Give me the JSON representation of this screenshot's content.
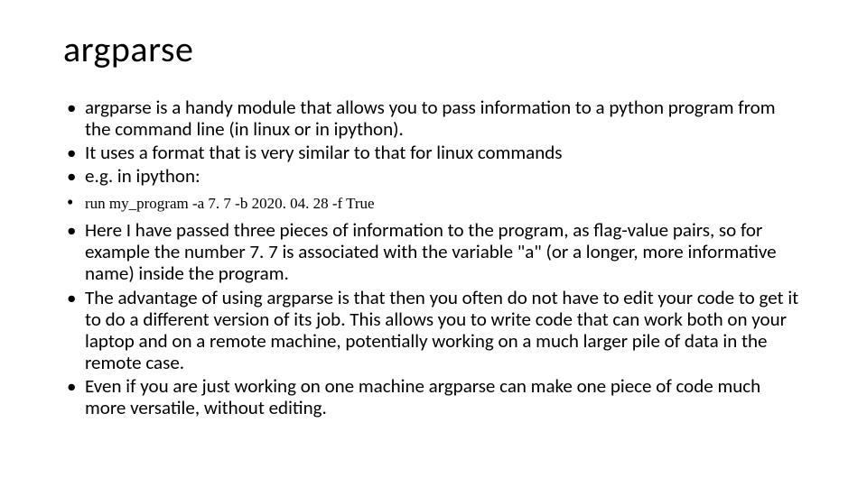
{
  "title": "argparse",
  "bullets": [
    {
      "text": "argparse is a handy module that allows you to pass information to a python program from the command line (in linux or in ipython).",
      "code": false
    },
    {
      "text": "It uses a format that is very similar to that for linux commands",
      "code": false
    },
    {
      "text": "e.g. in ipython:",
      "code": false
    },
    {
      "text": "run my_program -a 7. 7 -b 2020. 04. 28 -f True",
      "code": true
    },
    {
      "text": "Here I have passed three pieces of information to the program, as flag-value pairs, so for example the number 7. 7 is associated with the variable \"a\" (or a longer, more informative name) inside the program.",
      "code": false
    },
    {
      "text": "The advantage of using argparse is that then you often do not have to edit your code to get it to do a different version of its job.  This allows you to write code that can work both on your laptop and on a remote machine, potentially working on a much larger pile of data in the remote case.",
      "code": false
    },
    {
      "text": "Even if you are just working on one machine argparse can make one piece of code much more versatile, without editing.",
      "code": false
    }
  ]
}
